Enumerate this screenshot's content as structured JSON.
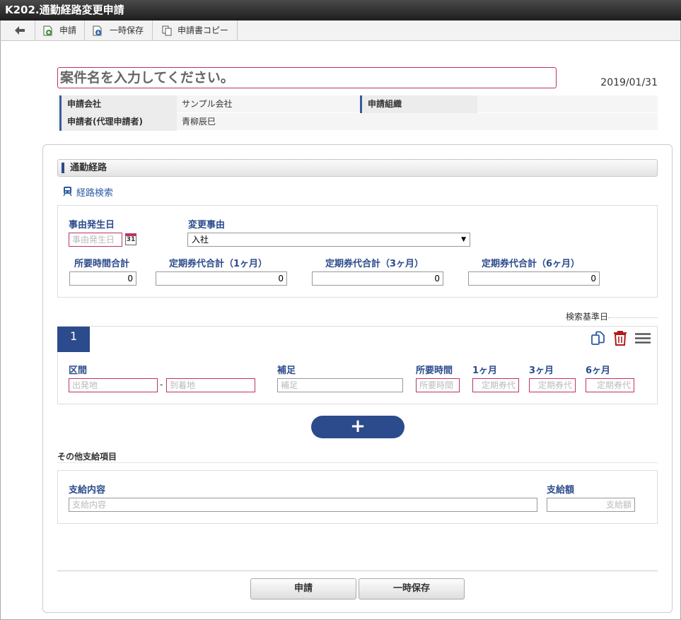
{
  "window": {
    "title": "K202.通勤経路変更申請"
  },
  "toolbar": {
    "apply": "申請",
    "temp_save": "一時保存",
    "copy": "申請書コピー"
  },
  "header": {
    "subject_placeholder": "案件名を入力してください。",
    "date": "2019/01/31",
    "company_label": "申請会社",
    "company_value": "サンプル会社",
    "org_label": "申請組織",
    "org_value": "",
    "applicant_label": "申請者(代理申請者)",
    "applicant_value": "青柳辰巳"
  },
  "route": {
    "section_title": "通勤経路",
    "search_link": "経路検索",
    "event_date_label": "事由発生日",
    "event_date_placeholder": "事由発生日",
    "calendar_text": "31",
    "reason_label": "変更事由",
    "reason_value": "入社",
    "total_time_label": "所要時間合計",
    "total_time_value": "0",
    "pass_1m_label": "定期券代合計（1ヶ月）",
    "pass_1m_value": "0",
    "pass_3m_label": "定期券代合計（3ヶ月）",
    "pass_3m_value": "0",
    "pass_6m_label": "定期券代合計（6ヶ月）",
    "pass_6m_value": "0",
    "base_date_label": "検索基準日"
  },
  "segment": {
    "number": "1",
    "section_label": "区間",
    "from_placeholder": "出発地",
    "dash": "-",
    "to_placeholder": "到着地",
    "note_label": "補足",
    "note_placeholder": "補足",
    "time_label": "所要時間",
    "time_placeholder": "所要時間",
    "m1_label": "1ヶ月",
    "m1_placeholder": "定期券代",
    "m3_label": "3ヶ月",
    "m3_placeholder": "定期券代",
    "m6_label": "6ヶ月",
    "m6_placeholder": "定期券代"
  },
  "add_button": "+",
  "other": {
    "title": "その他支給項目",
    "content_label": "支給内容",
    "content_placeholder": "支給内容",
    "amount_label": "支給額",
    "amount_placeholder": "支給額"
  },
  "footer": {
    "apply": "申請",
    "temp_save": "一時保存"
  }
}
